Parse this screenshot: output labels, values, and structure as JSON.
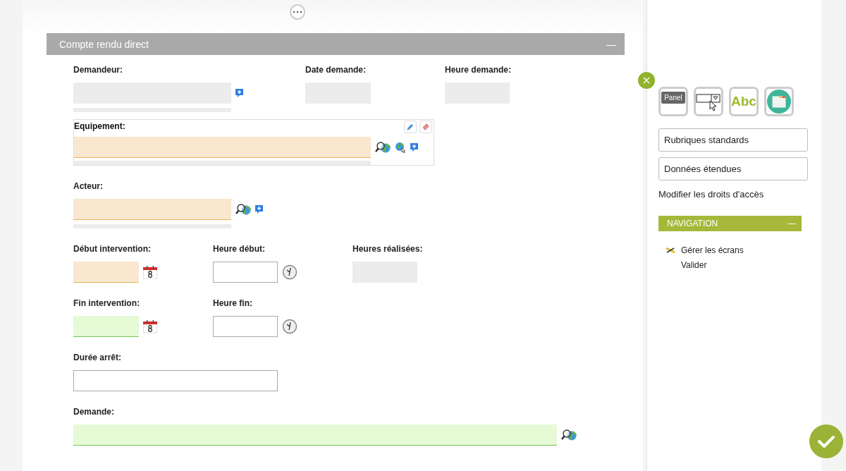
{
  "panel": {
    "title": "Compte rendu direct",
    "collapse": "—"
  },
  "rows": [
    {
      "fields": [
        {
          "label": "Demandeur:",
          "kind": "lookup",
          "input": {
            "kind": "readonly"
          },
          "selected": false,
          "icons": [
            {
              "kind": "add"
            }
          ]
        },
        {
          "label": "Date demande:",
          "kind": "date",
          "input": {
            "kind": "readonly"
          },
          "selected": false
        },
        {
          "label": "Heure demande:",
          "kind": "time",
          "input": {
            "kind": "readonly"
          },
          "selected": false
        }
      ]
    },
    {
      "fields": [
        {
          "label": "Equipement:",
          "kind": "wide",
          "input": {
            "kind": "required"
          },
          "selected": true,
          "icons": [
            {
              "kind": "search"
            },
            {
              "kind": "globe"
            },
            {
              "kind": "add"
            }
          ]
        }
      ]
    },
    {
      "fields": [
        {
          "label": "Acteur:",
          "kind": "lookup",
          "input": {
            "kind": "required"
          },
          "selected": false,
          "icons": [
            {
              "kind": "search"
            },
            {
              "kind": "add"
            }
          ]
        }
      ]
    },
    {
      "fields": [
        {
          "label": "Début intervention:",
          "kind": "date",
          "input": {
            "kind": "required"
          },
          "selected": false,
          "icons": [
            {
              "kind": "calendar"
            }
          ]
        },
        {
          "label": "Heure début:",
          "kind": "time",
          "input": {
            "kind": "empty"
          },
          "selected": false,
          "icons": [
            {
              "kind": "clock"
            }
          ]
        },
        {
          "label": "Heures réalisées:",
          "kind": "time",
          "input": {
            "kind": "readonly"
          },
          "selected": false
        }
      ]
    },
    {
      "fields": [
        {
          "label": "Fin intervention:",
          "kind": "date",
          "input": {
            "kind": "valid"
          },
          "selected": false,
          "icons": [
            {
              "kind": "calendar"
            }
          ]
        },
        {
          "label": "Heure fin:",
          "kind": "time",
          "input": {
            "kind": "empty"
          },
          "selected": false,
          "icons": [
            {
              "kind": "clock"
            }
          ]
        }
      ]
    },
    {
      "fields": [
        {
          "label": "Durée arrêt:",
          "kind": "duration",
          "input": {
            "kind": "empty"
          },
          "selected": false
        }
      ]
    },
    {
      "fields": [
        {
          "label": "Demande:",
          "kind": "memo",
          "input": {
            "kind": "valid"
          },
          "selected": false,
          "icons": [
            {
              "kind": "search"
            }
          ]
        }
      ]
    }
  ],
  "sidebar": {
    "tools": [
      {
        "kind": "panel",
        "label": "Panel"
      },
      {
        "kind": "dropdown"
      },
      {
        "kind": "text",
        "label": "Abc"
      },
      {
        "kind": "window"
      }
    ],
    "buttons": [
      "Rubriques standards",
      "Données étendues"
    ],
    "link": "Modifier les droits d'accès",
    "navigation": {
      "title": "NAVIGATION",
      "collapse": "—",
      "items": [
        {
          "label": "Gérer les écrans",
          "icon": true
        },
        {
          "label": "Valider",
          "icon": false
        }
      ]
    }
  }
}
